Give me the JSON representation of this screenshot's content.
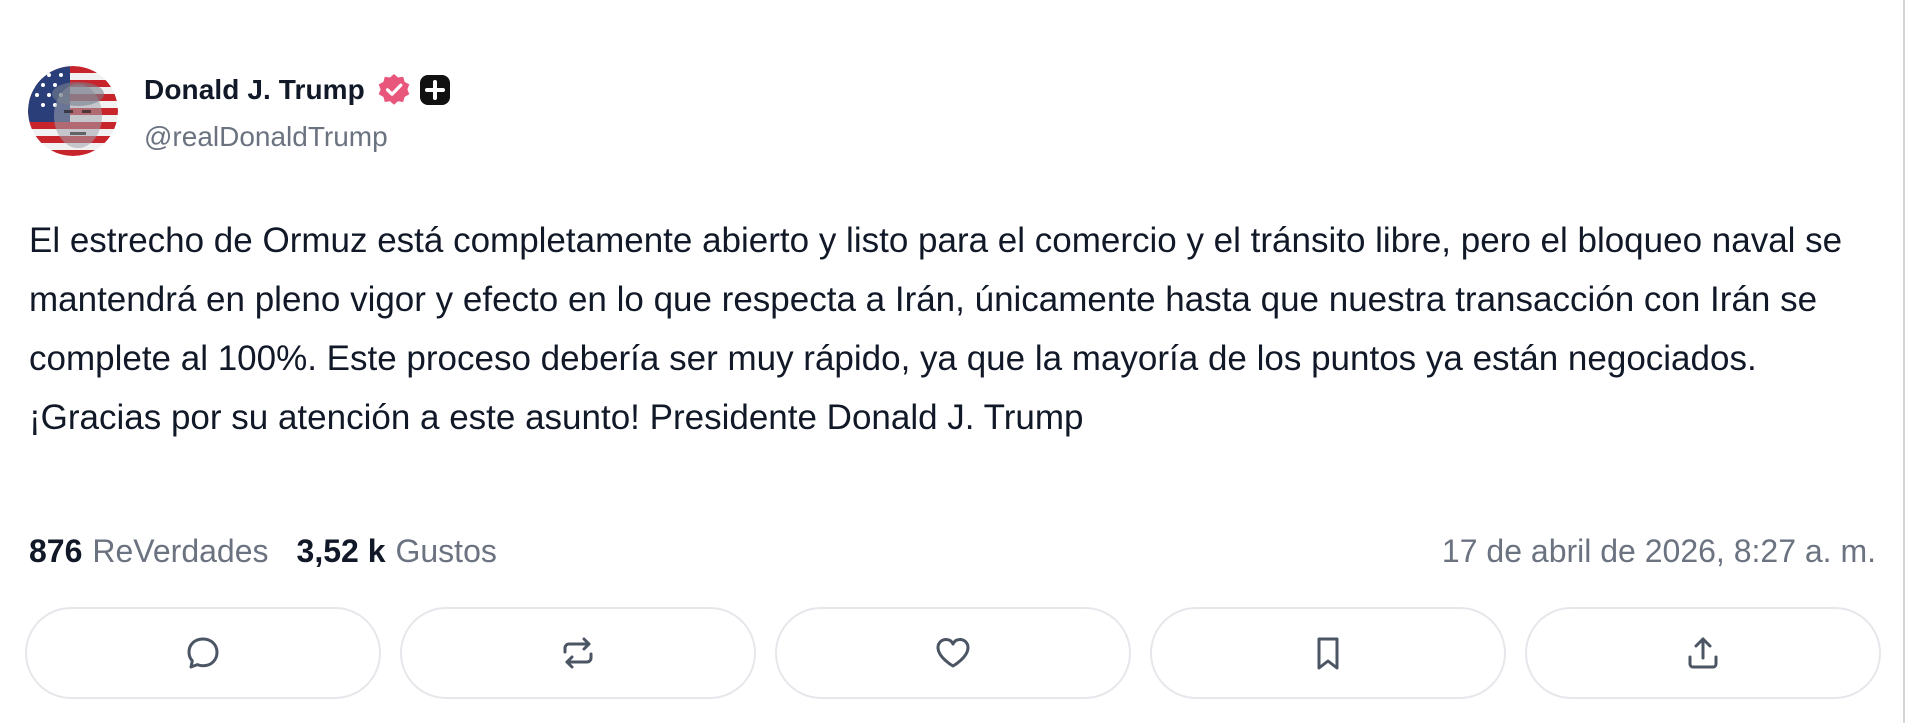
{
  "author": {
    "display_name": "Donald J. Trump",
    "handle": "@realDonaldTrump",
    "verified_badge_color": "#e8577b"
  },
  "post": {
    "text": "El estrecho de Ormuz está completamente abierto y listo para el comercio y el tránsito libre, pero el bloqueo naval se mantendrá en pleno vigor y efecto en lo que respecta a Irán, únicamente hasta que nuestra transacción con Irán se complete al 100%. Este proceso debería ser muy rápido, ya que la mayoría de los puntos ya están negociados. ¡Gracias por su atención a este asunto! Presidente Donald J. Trump"
  },
  "stats": {
    "retruths_count": "876",
    "retruths_label": "ReVerdades",
    "likes_count": "3,52 k",
    "likes_label": "Gustos",
    "timestamp": "17 de abril de 2026, 8:27 a. m."
  },
  "actions": [
    {
      "id": "reply",
      "icon": "chat-bubble-icon"
    },
    {
      "id": "retruth",
      "icon": "repost-icon"
    },
    {
      "id": "like",
      "icon": "heart-icon"
    },
    {
      "id": "bookmark",
      "icon": "bookmark-icon"
    },
    {
      "id": "share",
      "icon": "share-upload-icon"
    }
  ],
  "colors": {
    "text_primary": "#111827",
    "text_secondary": "#6b7280",
    "button_border": "#e5e7eb"
  }
}
